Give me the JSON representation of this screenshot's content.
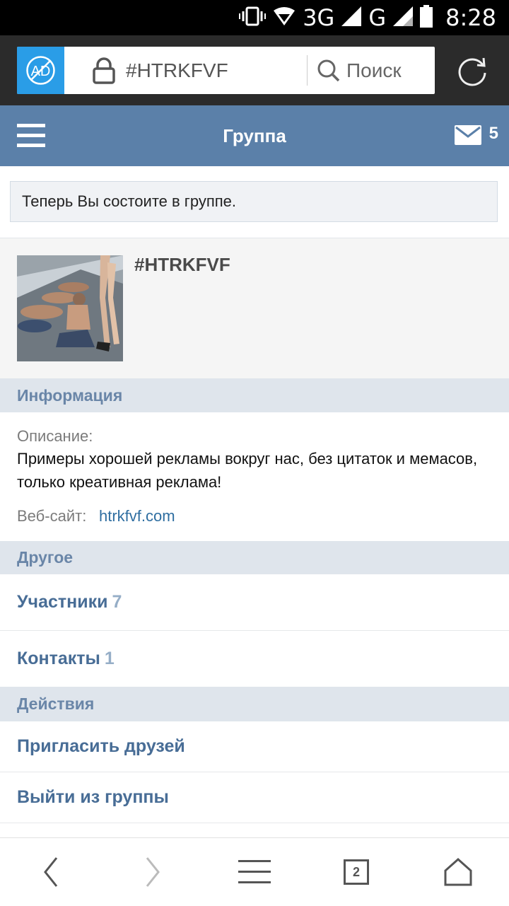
{
  "status_bar": {
    "network_1": "3G",
    "network_2": "G",
    "time": "8:28"
  },
  "browser": {
    "url": "#HTRKFVF",
    "search_placeholder": "Поиск",
    "adblock_label": "AD"
  },
  "header": {
    "title": "Группа",
    "messages_count": "5"
  },
  "notice": "Теперь Вы состоите в группе.",
  "group": {
    "name": "#HTRKFVF"
  },
  "info": {
    "heading": "Информация",
    "description_label": "Описание:",
    "description": "Примеры хорошей рекламы вокруг нас, без цитаток и мемасов, только креативная реклама!",
    "website_label": "Веб-сайт:",
    "website": "htrkfvf.com"
  },
  "other": {
    "heading": "Другое",
    "members_label": "Участники",
    "members_count": "7",
    "contacts_label": "Контакты",
    "contacts_count": "1"
  },
  "actions": {
    "heading": "Действия",
    "invite_label": "Пригласить друзей",
    "leave_label": "Выйти из группы"
  },
  "bottom_nav": {
    "tabs_count": "2"
  },
  "colors": {
    "header": "#5b80a9",
    "section": "#dfe5ec",
    "link": "#486d96",
    "adblock": "#2a9de7"
  }
}
